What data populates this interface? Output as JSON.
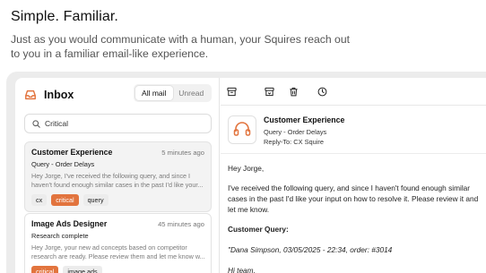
{
  "hero": {
    "headline": "Simple. Familiar.",
    "sub": "Just as you would communicate with a human, your Squires reach out to you in a familiar email-like experience."
  },
  "inbox": {
    "title": "Inbox",
    "filters": [
      "All mail",
      "Unread"
    ],
    "active_filter": "All mail",
    "search_value": "Critical"
  },
  "messages": [
    {
      "title": "Customer Experience",
      "time": "5 minutes ago",
      "subject": "Query - Order Delays",
      "snippet": "Hey Jorge, I've received the following query, and since I haven't found enough similar cases in the past I'd like your...",
      "tags": [
        "cx",
        "critical",
        "query"
      ]
    },
    {
      "title": "Image Ads Designer",
      "time": "45 minutes ago",
      "subject": "Research complete",
      "snippet": "Hey Jorge, your new ad concepts based on competitor research are ready. Please review them and let me know w...",
      "tags": [
        "critical",
        "image ads"
      ]
    }
  ],
  "toolbar": {
    "icons": [
      "archive-icon",
      "archive-alt-icon",
      "trash-icon",
      "clock-icon"
    ]
  },
  "email": {
    "sender_name": "Customer Experience",
    "subject": "Query - Order Delays",
    "reply_to": "Reply-To: CX Squire",
    "greeting": "Hey Jorge,",
    "paragraph": "I've received the following query, and since I haven't found enough similar cases in the past I'd like your input on how to resolve it. Please review it and let me know.",
    "query_label": "Customer Query:",
    "query_meta": "\"Dana Simpson, 03/05/2025 - 22:34, order: #3014",
    "query_greeting": "Hi team,"
  },
  "colors": {
    "accent": "#e2743e",
    "frame": "#ececec"
  }
}
